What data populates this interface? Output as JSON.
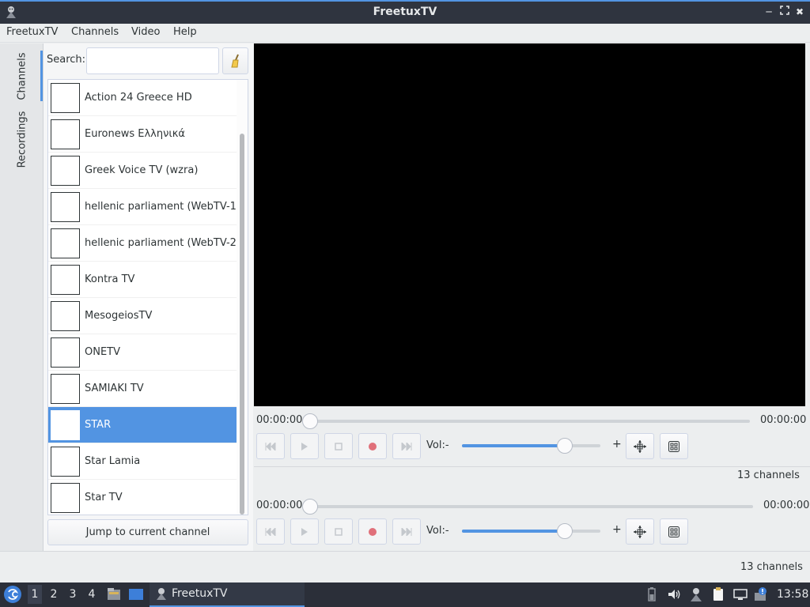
{
  "window": {
    "title": "FreetuxTV"
  },
  "menu": [
    "FreetuxTV",
    "Channels",
    "Video",
    "Help"
  ],
  "side_tabs": [
    "Channels",
    "Recordings"
  ],
  "search": {
    "label": "Search:",
    "value": "",
    "placeholder": ""
  },
  "channels": [
    "Action 24 Greece HD",
    "Euronews Ελληνικά",
    "Greek Voice TV (wzra)",
    "hellenic parliament (WebTV-1",
    "hellenic parliament (WebTV-2",
    "Kontra TV",
    "MesogeiosTV",
    "ONETV",
    "SAMIAKI TV",
    "STAR",
    "Star Lamia",
    "Star TV"
  ],
  "selected_channel": "STAR",
  "jump_button": "Jump to current channel",
  "player": [
    {
      "time_start": "00:00:00",
      "time_end": "00:00:00",
      "vol_label": "Vol:-",
      "vol_plus": "+",
      "volume_fraction": 0.74,
      "status": "13 channels"
    },
    {
      "time_start": "00:00:00",
      "time_end": "00:00:00",
      "vol_label": "Vol:-",
      "vol_plus": "+",
      "volume_fraction": 0.74,
      "status": "13 channels"
    }
  ],
  "colors": {
    "accent": "#5294e2",
    "titlebar": "#2f343f",
    "taskbar": "#2b2f39",
    "record": "#e0707a"
  },
  "taskbar": {
    "workspaces": [
      "1",
      "2",
      "3",
      "4"
    ],
    "current_workspace": "1",
    "task_label": "FreetuxTV",
    "clock": "13:58",
    "tray_icons": [
      "battery-icon",
      "volume-icon",
      "network-user-icon",
      "clipboard-icon",
      "display-icon",
      "update-notifier-icon"
    ]
  }
}
